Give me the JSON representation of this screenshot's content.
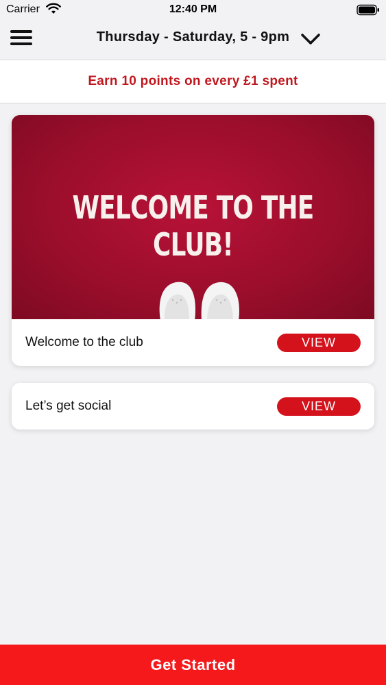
{
  "status_bar": {
    "carrier": "Carrier",
    "time": "12:40 PM",
    "wifi_icon": "wifi-icon",
    "battery_icon": "battery-full-icon"
  },
  "nav": {
    "title": "Thursday - Saturday, 5 - 9pm",
    "menu_icon": "hamburger-menu-icon",
    "dropdown_icon": "chevron-down-icon"
  },
  "banner": {
    "text": "Earn 10 points on every £1 spent",
    "color": "#c0161d"
  },
  "cards": [
    {
      "image_text": "WELCOME TO THE CLUB!",
      "label": "Welcome to the club",
      "button_label": "VIEW"
    },
    {
      "label": "Let’s get social",
      "button_label": "VIEW"
    }
  ],
  "cta": {
    "label": "Get Started",
    "color": "#f5191c"
  }
}
